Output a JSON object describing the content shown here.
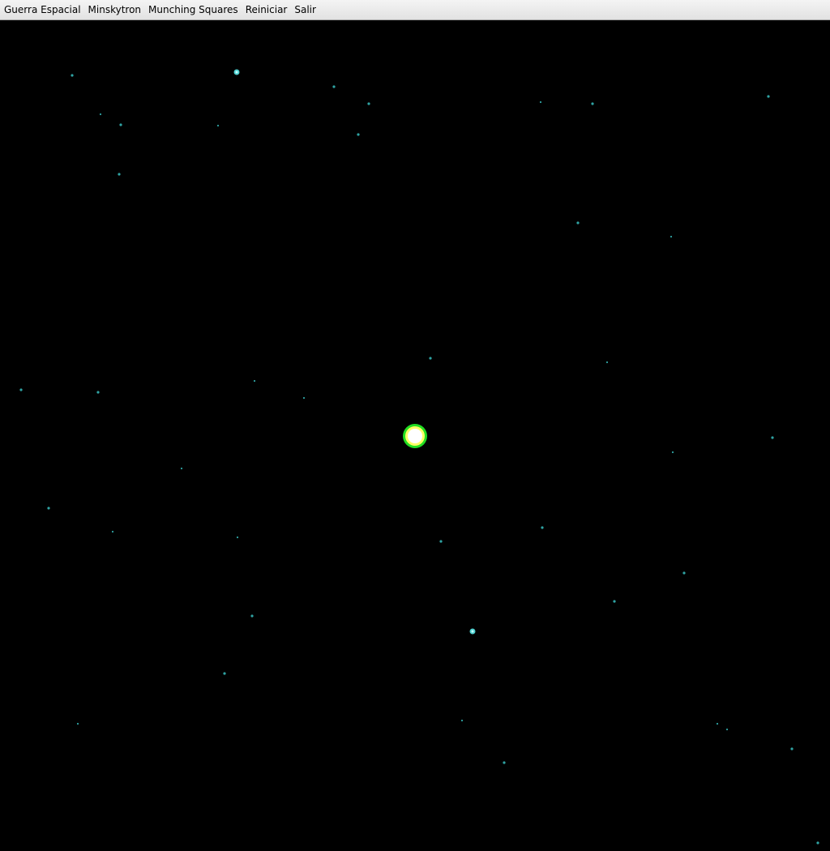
{
  "menu": {
    "items": [
      {
        "label": "Guerra Espacial"
      },
      {
        "label": "Minskytron"
      },
      {
        "label": "Munching Squares"
      },
      {
        "label": "Reiniciar"
      },
      {
        "label": "Salir"
      }
    ]
  },
  "colors": {
    "background": "#000000",
    "star": "#2fa3a3",
    "star_bright": "#4fd0d0",
    "sun_core": "#ffffff",
    "sun_inner_ring": "#ffff66",
    "sun_outer_ring": "#22dd22"
  }
}
